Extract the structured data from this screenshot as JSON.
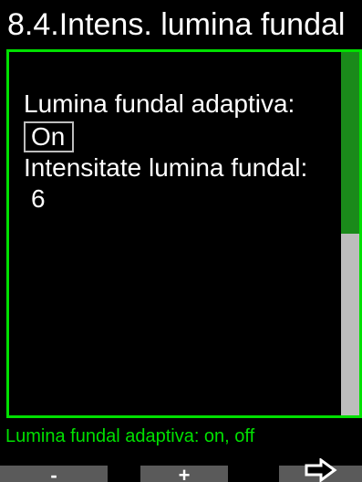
{
  "header": {
    "title": "8.4.Intens. lumina fundal"
  },
  "settings": {
    "adaptive_label": "Lumina fundal adaptiva:",
    "adaptive_value": "On",
    "intensity_label": "Intensitate lumina fundal:",
    "intensity_value": "6"
  },
  "scrollbar": {
    "position_fraction": 0.5
  },
  "help": {
    "text": "Lumina fundal adaptiva: on, off"
  },
  "softkeys": {
    "minus": "-",
    "plus": "+",
    "next_icon": "arrow-right-outline-icon"
  },
  "colors": {
    "accent": "#00e000",
    "scroll_thumb": "#1a8a1a",
    "softkey_bg": "#5a5a5a"
  }
}
